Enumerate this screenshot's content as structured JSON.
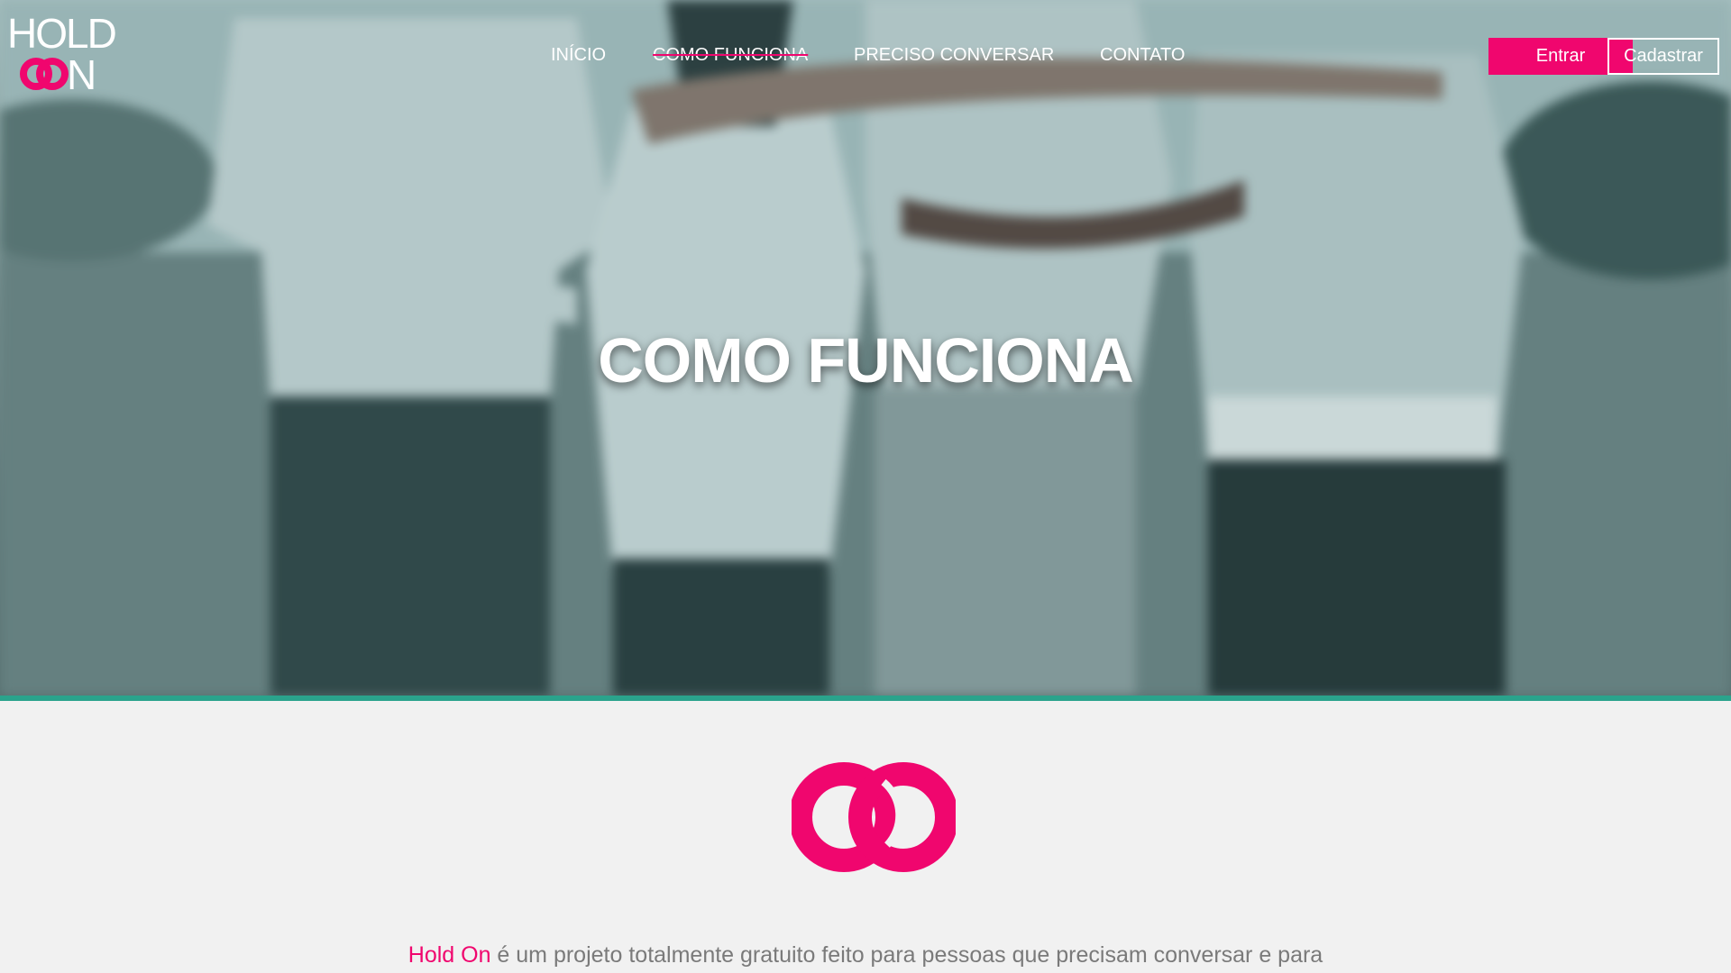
{
  "brand": {
    "logo_line1": "HOLD",
    "logo_line2": "N",
    "logo_icon": "interlocked-rings-icon",
    "accent_color": "#f0066e",
    "divider_color": "#2aa38c"
  },
  "nav": {
    "items": [
      {
        "label": "INÍCIO",
        "active": false
      },
      {
        "label": "COMO FUNCIONA",
        "active": true
      },
      {
        "label": "PRECISO CONVERSAR",
        "active": false
      },
      {
        "label": "CONTATO",
        "active": false
      }
    ]
  },
  "auth": {
    "login_label": "Entrar",
    "signup_label": "Cadastrar"
  },
  "hero": {
    "title": "COMO FUNCIONA"
  },
  "intro": {
    "brand_name": "Hold On",
    "text": " é um projeto totalmente gratuito feito para pessoas que precisam conversar e para"
  }
}
